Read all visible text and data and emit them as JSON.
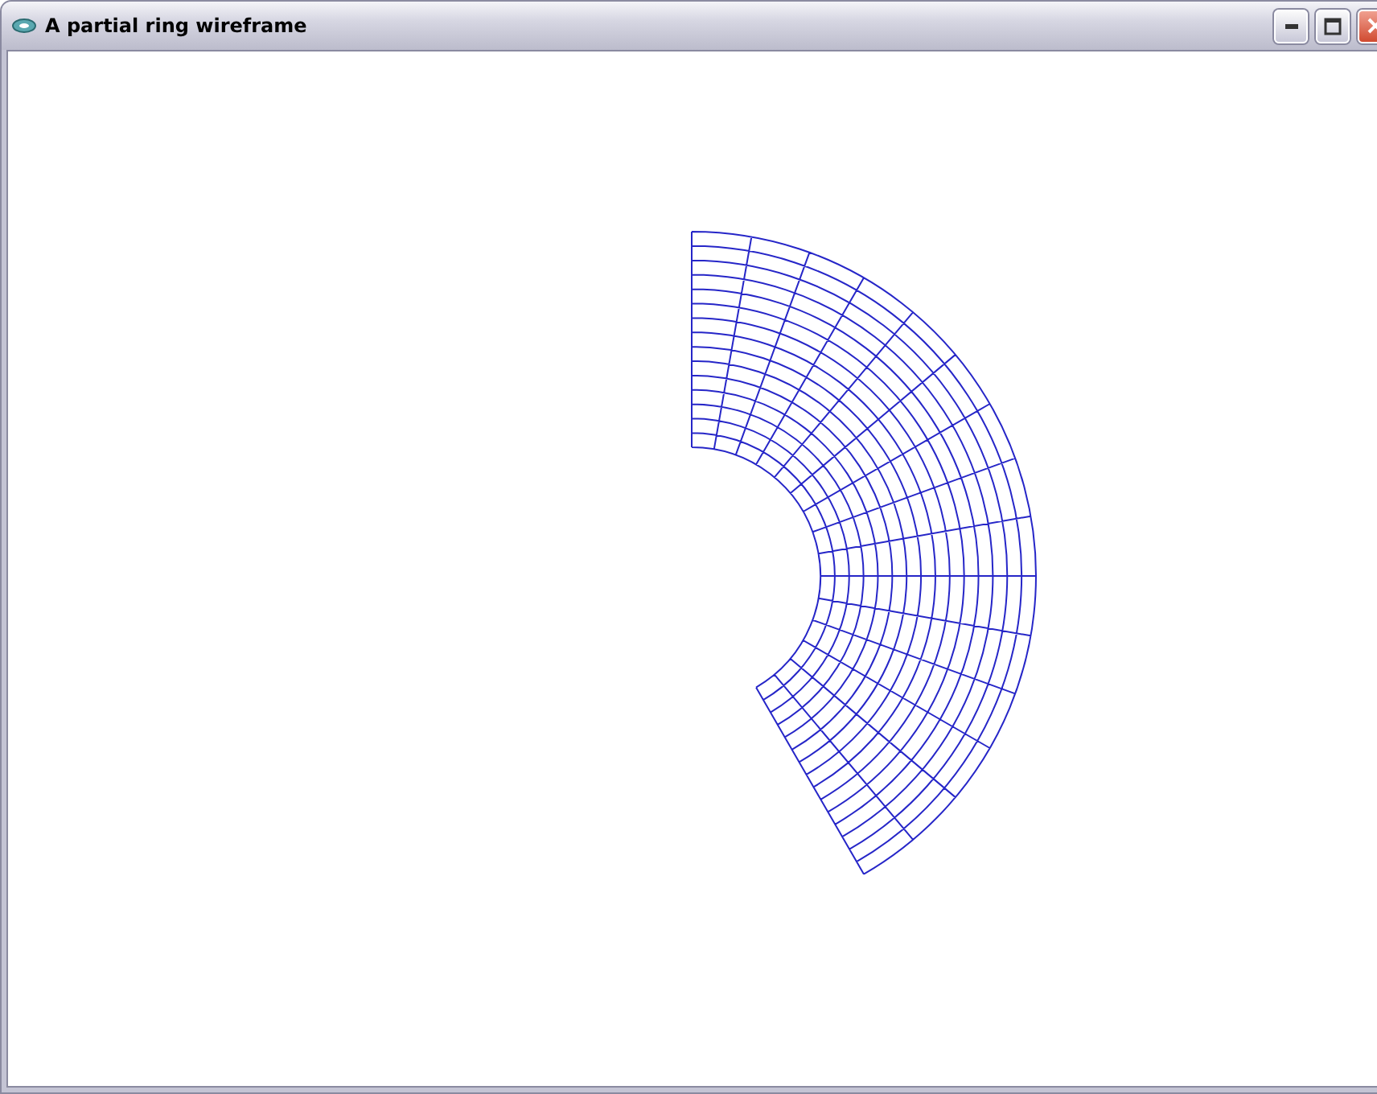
{
  "window": {
    "title": "A partial ring wireframe"
  }
}
